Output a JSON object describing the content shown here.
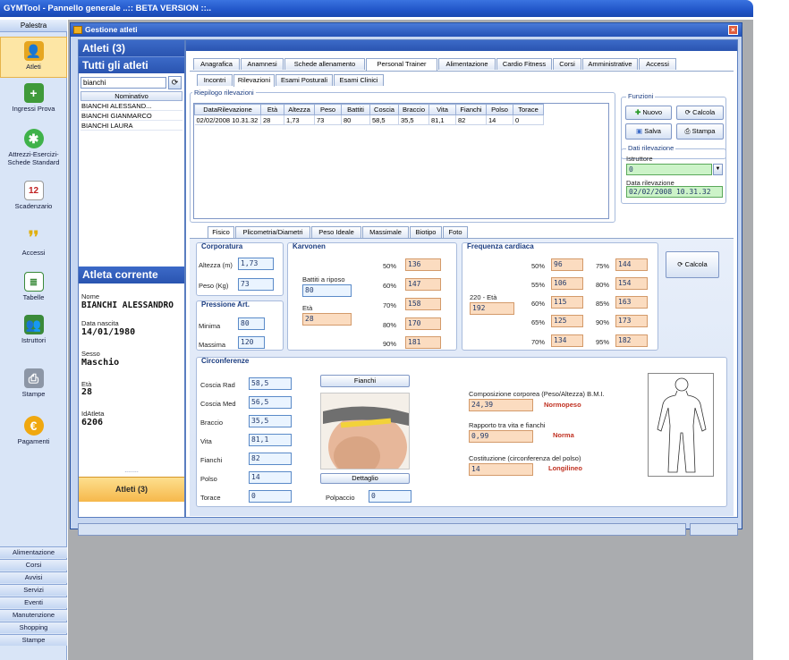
{
  "window_title": "GYMTool - Pannello generale ..:: BETA VERSION ::..",
  "nav": {
    "header": "Palestra",
    "items": [
      {
        "label": "Atleti",
        "icon": "athletes-icon"
      },
      {
        "label": "Ingressi Prova",
        "icon": "trial-entry-icon"
      },
      {
        "label": "Attrezzi-Esercizi-Schede Standard",
        "icon": "equipment-icon"
      },
      {
        "label": "Scadenzario",
        "icon": "calendar-icon",
        "icon_text": "12"
      },
      {
        "label": "Accessi",
        "icon": "footprints-icon"
      },
      {
        "label": "Tabelle",
        "icon": "table-icon"
      },
      {
        "label": "Istruttori",
        "icon": "instructors-icon"
      },
      {
        "label": "Stampe",
        "icon": "printer-icon"
      },
      {
        "label": "Pagamenti",
        "icon": "payments-icon"
      }
    ],
    "bottom": [
      "Alimentazione",
      "Corsi",
      "Avvisi",
      "Servizi",
      "Eventi",
      "Manutenzione",
      "Shopping",
      "Stampe"
    ]
  },
  "gwin": {
    "title": "Gestione atleti",
    "list_title": "Atleti (3)",
    "list_subtitle": "Tutti gli atleti",
    "search_value": "bianchi",
    "list_header": "Nominativo",
    "list_rows": [
      "BIANCHI ALESSAND...",
      "BIANCHI GIANMARCO",
      "BIANCHI LAURA"
    ],
    "current": {
      "header": "Atleta corrente",
      "nome_label": "Nome",
      "nome": "BIANCHI ALESSANDRO",
      "nascita_label": "Data nascita",
      "nascita": "14/01/1980",
      "sesso_label": "Sesso",
      "sesso": "Maschio",
      "eta_label": "Età",
      "eta": "28",
      "id_label": "IdAtleta",
      "id": "6206"
    },
    "dots": "........",
    "bottom_btn": "Atleti (3)"
  },
  "tabs_top": [
    "Anagrafica",
    "Anamnesi",
    "Schede allenamento",
    "Personal Trainer",
    "Alimentazione",
    "Cardio Fitness",
    "Corsi",
    "Amministrative",
    "Accessi"
  ],
  "tabs_sub": [
    "Incontri",
    "Rilevazioni",
    "Esami Posturali",
    "Esami Clinici"
  ],
  "riepilogo": {
    "label": "Riepilogo rilevazioni",
    "columns": [
      "DataRilevazione",
      "Età",
      "Altezza",
      "Peso",
      "Battiti",
      "Coscia",
      "Braccio",
      "Vita",
      "Fianchi",
      "Polso",
      "Torace"
    ],
    "rows": [
      [
        "02/02/2008 10.31.32",
        "28",
        "1,73",
        "73",
        "80",
        "58,5",
        "35,5",
        "81,1",
        "82",
        "14",
        "0"
      ]
    ]
  },
  "funzioni": {
    "label": "Funzioni",
    "nuovo": "Nuovo",
    "calcola": "Calcola",
    "salva": "Salva",
    "stampa": "Stampa",
    "dati_label": "Dati rilevazione",
    "istruttore_label": "Istruttore",
    "istruttore_value": "0",
    "data_label": "Data rilevazione",
    "data_value": "02/02/2008 10.31.32"
  },
  "tabs_fisico": [
    "Fisico",
    "Plicometria/Diametri",
    "Peso Ideale",
    "Massimale",
    "Biotipo",
    "Foto"
  ],
  "corporatura": {
    "label": "Corporatura",
    "altezza_label": "Altezza (m)",
    "altezza": "1,73",
    "peso_label": "Peso (Kg)",
    "peso": "73"
  },
  "pressione": {
    "label": "Pressione Art.",
    "minima_label": "Minima",
    "minima": "80",
    "massima_label": "Massima",
    "massima": "120"
  },
  "karvonen": {
    "label": "Karvonen",
    "battiti_label": "Battiti a riposo",
    "battiti": "80",
    "eta_label": "Età",
    "eta": "28",
    "rows": [
      {
        "p": "50%",
        "v": "136"
      },
      {
        "p": "60%",
        "v": "147"
      },
      {
        "p": "70%",
        "v": "158"
      },
      {
        "p": "80%",
        "v": "170"
      },
      {
        "p": "90%",
        "v": "181"
      }
    ]
  },
  "frequenza": {
    "label": "Frequenza cardiaca",
    "eta_label": "220 - Età",
    "eta_value": "192",
    "left": [
      {
        "p": "50%",
        "v": "96"
      },
      {
        "p": "55%",
        "v": "106"
      },
      {
        "p": "60%",
        "v": "115"
      },
      {
        "p": "65%",
        "v": "125"
      },
      {
        "p": "70%",
        "v": "134"
      }
    ],
    "right": [
      {
        "p": "75%",
        "v": "144"
      },
      {
        "p": "80%",
        "v": "154"
      },
      {
        "p": "85%",
        "v": "163"
      },
      {
        "p": "90%",
        "v": "173"
      },
      {
        "p": "95%",
        "v": "182"
      }
    ],
    "calcola": "Calcola"
  },
  "circonferenze": {
    "label": "Circonferenze",
    "fields": [
      {
        "label": "Coscia Rad",
        "value": "58,5"
      },
      {
        "label": "Coscia Med",
        "value": "56,5"
      },
      {
        "label": "Braccio",
        "value": "35,5"
      },
      {
        "label": "Vita",
        "value": "81,1"
      },
      {
        "label": "Fianchi",
        "value": "82"
      },
      {
        "label": "Polso",
        "value": "14"
      },
      {
        "label": "Torace",
        "value": "0"
      }
    ],
    "fianchi_btn": "Fianchi",
    "dettaglio_btn": "Dettaglio",
    "polpaccio_label": "Polpaccio",
    "polpaccio": "0",
    "bmi_label": "Composizione corporea (Peso/Altezza) B.M.I.",
    "bmi": "24,39",
    "bmi_status": "Normopeso",
    "rvf_label": "Rapporto tra vita e fianchi",
    "rvf": "0,99",
    "rvf_status": "Norma",
    "cost_label": "Costituzione (circonferenza del polso)",
    "cost": "14",
    "cost_status": "Longilineo"
  }
}
